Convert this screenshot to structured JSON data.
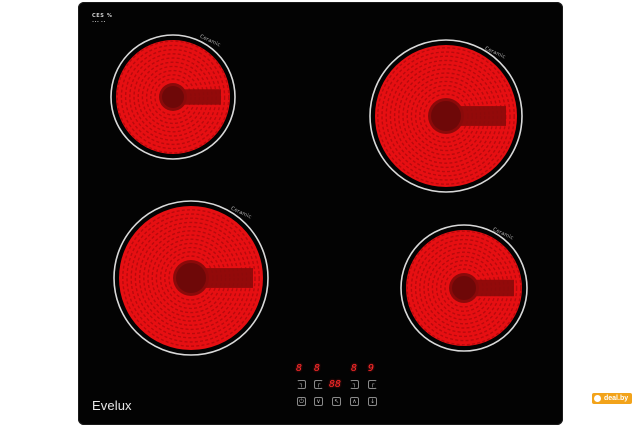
{
  "cooktop": {
    "top_logo_line1": "CES %",
    "top_logo_line2": "••• ••",
    "brand": "Evelux",
    "zone_label": "Ceramic",
    "colors": {
      "glass": "#030303",
      "heat": "#e60f12",
      "heat_dark": "#8a0a0a",
      "ring": "#d9d9d9"
    }
  },
  "zones": [
    {
      "id": "front-left"
    },
    {
      "id": "rear-right"
    },
    {
      "id": "rear-left"
    },
    {
      "id": "front-right"
    }
  ],
  "control_panel": {
    "displays": [
      "8",
      "8",
      "8",
      "9"
    ],
    "center_display": "88",
    "buttons": [
      {
        "name": "zone1-select",
        "glyph": "┐"
      },
      {
        "name": "zone2-select",
        "glyph": "┌"
      },
      {
        "name": "zone3-select",
        "glyph": "┐"
      },
      {
        "name": "zone4-select",
        "glyph": "┌"
      },
      {
        "name": "power",
        "glyph": "⏻"
      },
      {
        "name": "minus",
        "glyph": "∨"
      },
      {
        "name": "lock",
        "glyph": "↖"
      },
      {
        "name": "plus",
        "glyph": "∧"
      },
      {
        "name": "timer",
        "glyph": "↓"
      }
    ]
  },
  "watermark": {
    "text": "deal.by"
  }
}
